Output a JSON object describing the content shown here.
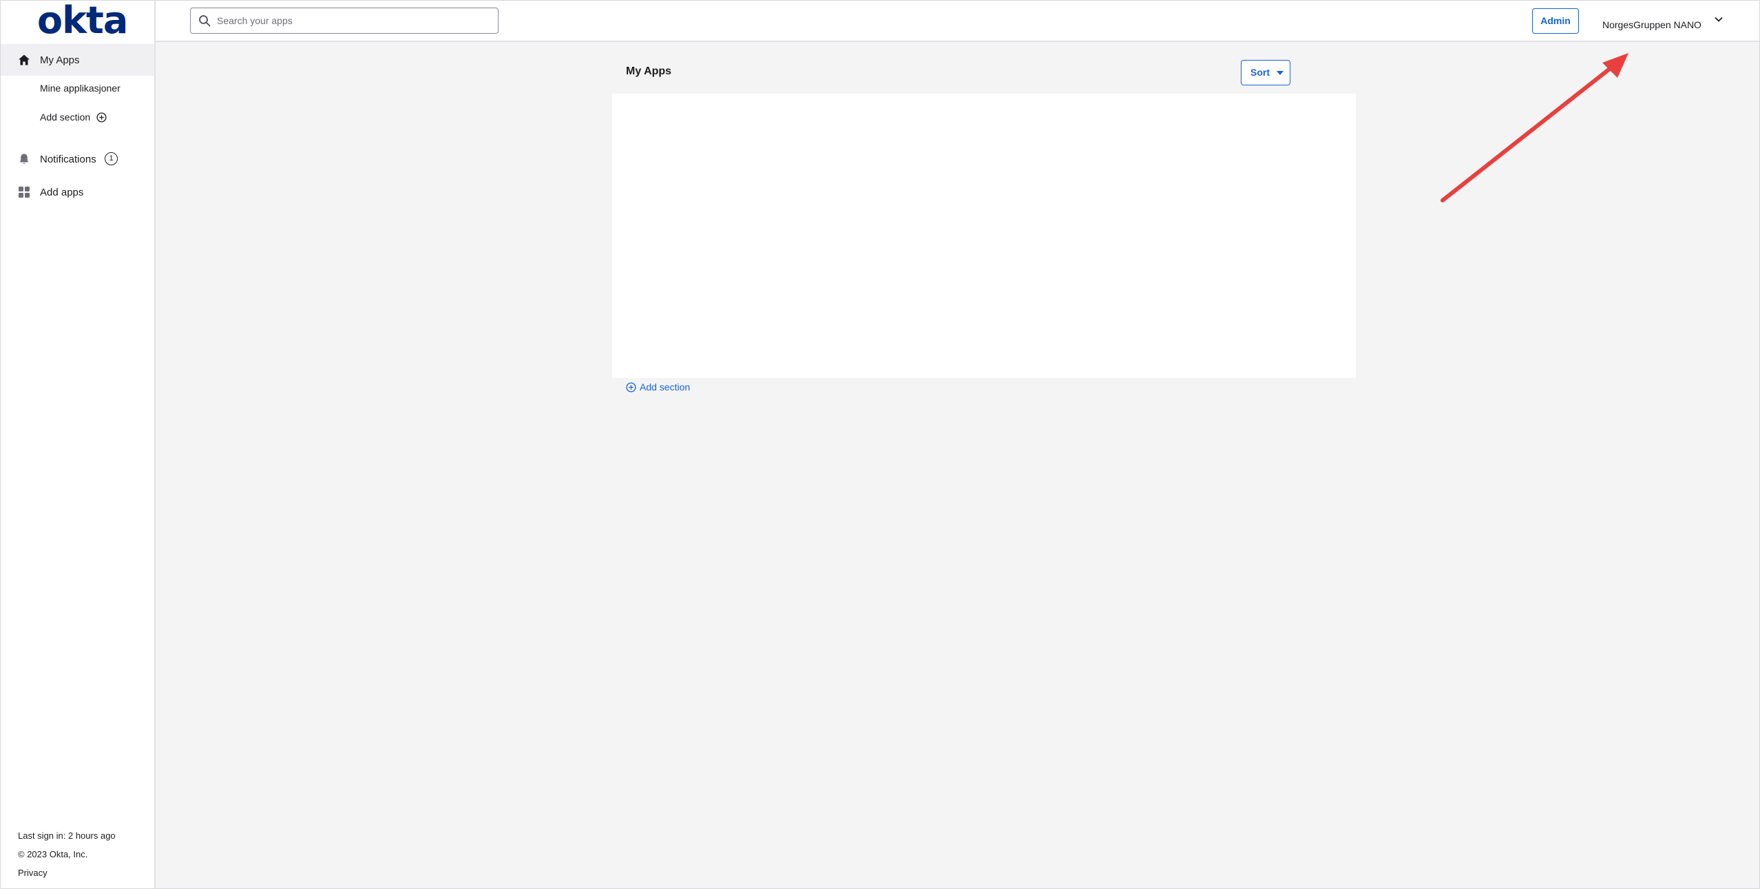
{
  "brand": {
    "logo_text": "okta",
    "logo_color": "#00297a"
  },
  "search": {
    "placeholder": "Search your apps",
    "value": ""
  },
  "header": {
    "admin_label": "Admin",
    "user_name": "NorgesGruppen NANO"
  },
  "sidebar": {
    "my_apps": "My Apps",
    "sections": [
      "Mine applikasjoner"
    ],
    "add_section": "Add section",
    "notifications": "Notifications",
    "notifications_count": "1",
    "add_apps": "Add apps"
  },
  "footer": {
    "last_sign_in": "Last sign in: 2 hours ago",
    "copyright": "© 2023 Okta, Inc.",
    "privacy": "Privacy"
  },
  "main": {
    "title": "My Apps",
    "sort_label": "Sort",
    "add_section": "Add section"
  },
  "colors": {
    "accent": "#1662dd",
    "annotation_arrow": "#e8403f"
  }
}
